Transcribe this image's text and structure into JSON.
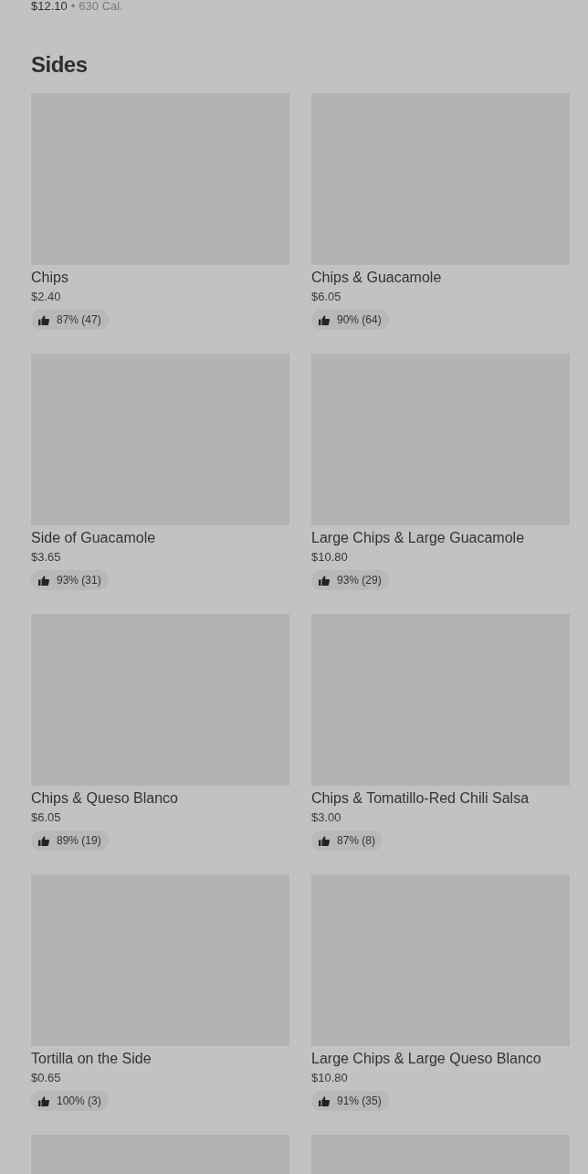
{
  "previous_item": {
    "price": "$12.10",
    "separator": "•",
    "calories": "630 Cal."
  },
  "section": {
    "title": "Sides"
  },
  "items": [
    {
      "kind": "item",
      "name": "Chips",
      "price": "$2.40",
      "rating": "87% (47)"
    },
    {
      "kind": "item",
      "name": "Chips & Guacamole",
      "price": "$6.05",
      "rating": "90% (64)"
    },
    {
      "kind": "item",
      "name": "Side of Guacamole",
      "price": "$3.65",
      "rating": "93% (31)"
    },
    {
      "kind": "item",
      "name": "Large Chips & Large Guacamole",
      "price": "$10.80",
      "rating": "93% (29)"
    },
    {
      "kind": "item",
      "name": "Chips & Queso Blanco",
      "price": "$6.05",
      "rating": "89% (19)"
    },
    {
      "kind": "item",
      "name": "Chips & Tomatillo-Red Chili Salsa",
      "price": "$3.00",
      "rating": "87% (8)"
    },
    {
      "kind": "item",
      "name": "Tortilla on the Side",
      "price": "$0.65",
      "rating": "100% (3)"
    },
    {
      "kind": "item",
      "name": "Large Chips & Large Queso Blanco",
      "price": "$10.80",
      "rating": "91% (35)"
    },
    {
      "kind": "cut"
    },
    {
      "kind": "cut"
    }
  ]
}
